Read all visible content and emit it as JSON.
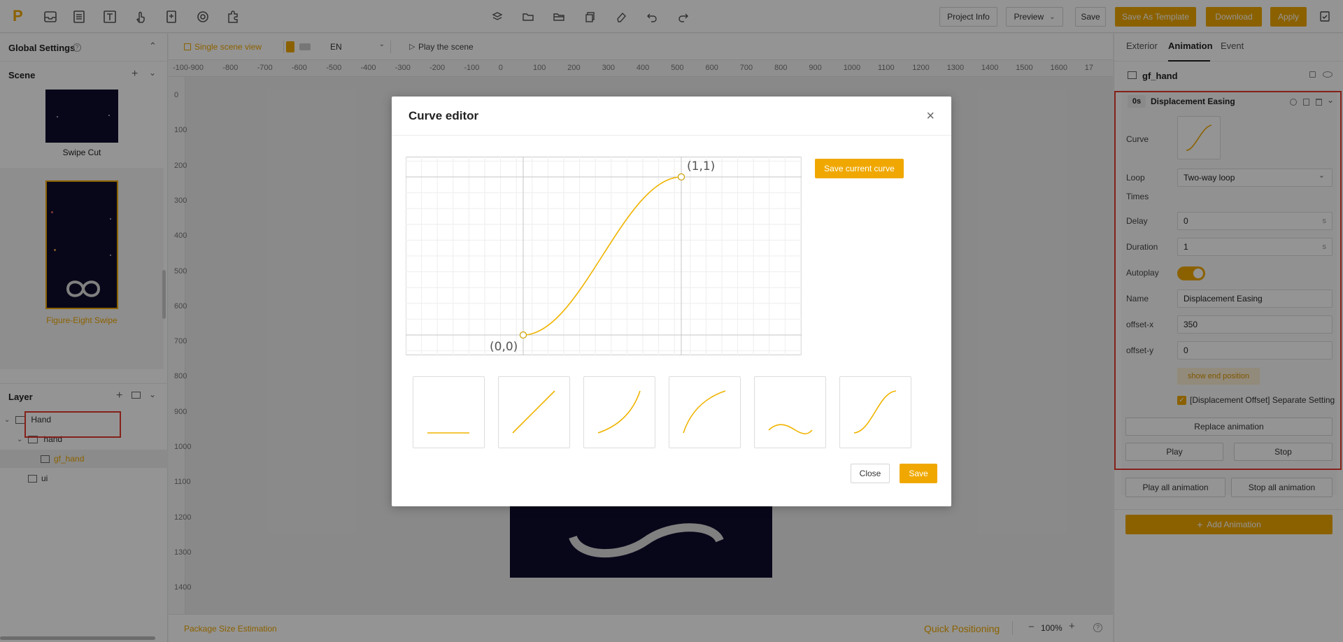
{
  "toolbar": {
    "project_info": "Project Info",
    "preview": "Preview",
    "save": "Save",
    "save_as_template": "Save As Template",
    "download": "Download",
    "apply": "Apply"
  },
  "left": {
    "global_settings": "Global Settings",
    "scene_label": "Scene",
    "scenes": [
      {
        "name": "Swipe Cut"
      },
      {
        "name": "Figure-Eight Swipe"
      }
    ],
    "layer_label": "Layer",
    "layers": [
      {
        "name": "Hand"
      },
      {
        "name": "hand"
      },
      {
        "name": "gf_hand"
      },
      {
        "name": "ui"
      }
    ]
  },
  "center": {
    "single_scene_view": "Single scene view",
    "language": "EN",
    "play_scene": "Play the scene",
    "ruler_x": [
      "-100",
      "-900",
      "-800",
      "-700",
      "-600",
      "-500",
      "-400",
      "-300",
      "-200",
      "-100",
      "0",
      "100",
      "200",
      "300",
      "400",
      "500",
      "600",
      "700",
      "800",
      "900",
      "1000",
      "1100",
      "1200",
      "1300",
      "1400",
      "1500",
      "1600",
      "17"
    ],
    "ruler_y": [
      "0",
      "100",
      "200",
      "300",
      "400",
      "500",
      "600",
      "700",
      "800",
      "900",
      "1000",
      "1100",
      "1200",
      "1300",
      "1400"
    ],
    "package_size": "Package Size Estimation",
    "quick_positioning": "Quick Positioning",
    "zoom": "100%"
  },
  "right": {
    "tabs": [
      "Exterior",
      "Animation",
      "Event"
    ],
    "active_tab": "Animation",
    "element_name": "gf_hand",
    "anim": {
      "time": "0s",
      "title": "Displacement Easing",
      "curve_label": "Curve",
      "loop_label": "Loop",
      "loop_value": "Two-way loop",
      "times_label": "Times",
      "delay_label": "Delay",
      "delay_value": "0",
      "duration_label": "Duration",
      "duration_value": "1",
      "unit_s": "s",
      "autoplay_label": "Autoplay",
      "autoplay": true,
      "name_label": "Name",
      "name_value": "Displacement Easing",
      "offset_x_label": "offset-x",
      "offset_x_value": "350",
      "offset_y_label": "offset-y",
      "offset_y_value": "0",
      "show_end_position": "show end position",
      "separate_setting": "[Displacement Offset] Separate Setting",
      "replace_animation": "Replace animation",
      "play": "Play",
      "stop": "Stop"
    },
    "play_all": "Play all animation",
    "stop_all": "Stop all animation",
    "add_animation": "Add Animation"
  },
  "modal": {
    "title": "Curve editor",
    "save_current_curve": "Save current curve",
    "point_start": "(0,0)",
    "point_end": "(1,1)",
    "close": "Close",
    "save": "Save",
    "presets": [
      "flat",
      "linear",
      "ease-in",
      "ease-out",
      "wave",
      "ease-in-out"
    ]
  },
  "colors": {
    "accent": "#f0a800",
    "highlight": "#e53a2e",
    "artboard": "#0e0d2e"
  }
}
